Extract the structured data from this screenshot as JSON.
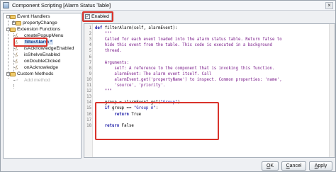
{
  "window": {
    "title": "Component Scripting [Alarm Status Table]"
  },
  "tree": {
    "event_handlers": "Event Handlers",
    "property_change": "propertyChange",
    "extension_functions": "Extension Functions",
    "functions": [
      {
        "label": "createPopupMenu"
      },
      {
        "label": "filterAlarm *",
        "selected": true
      },
      {
        "label": "isAcknowledgeEnabled"
      },
      {
        "label": "isShelveEnabled"
      },
      {
        "label": "onDoubleClicked"
      },
      {
        "label": "onAcknowledge"
      }
    ],
    "custom_methods": "Custom Methods",
    "add_method": "Add method"
  },
  "enabled": {
    "label": "Enabled",
    "checked": true
  },
  "code": {
    "lines": [
      {
        "n": "1",
        "parts": [
          {
            "c": "kw",
            "t": "def "
          },
          {
            "c": "plain",
            "t": "filterAlarm(self, alarmEvent):"
          }
        ]
      },
      {
        "n": "2",
        "parts": [
          {
            "c": "doc",
            "t": "    \"\"\""
          }
        ]
      },
      {
        "n": "3",
        "parts": [
          {
            "c": "doc",
            "t": "    Called for each event loaded into the alarm status table. Return false to"
          }
        ]
      },
      {
        "n": "4",
        "parts": [
          {
            "c": "doc",
            "t": "    hide this event from the table. This code is executed in a background"
          }
        ]
      },
      {
        "n": "5",
        "parts": [
          {
            "c": "doc",
            "t": "    thread."
          }
        ]
      },
      {
        "n": "6",
        "parts": [
          {
            "c": "doc",
            "t": ""
          }
        ]
      },
      {
        "n": "7",
        "parts": [
          {
            "c": "doc",
            "t": "    Arguments:"
          }
        ]
      },
      {
        "n": "8",
        "parts": [
          {
            "c": "doc",
            "t": "        self: A reference to the component that is invoking this function."
          }
        ]
      },
      {
        "n": "9",
        "parts": [
          {
            "c": "doc",
            "t": "        alarmEvent: The alarm event itself. Call"
          }
        ]
      },
      {
        "n": "10",
        "parts": [
          {
            "c": "doc",
            "t": "        alarmEvent.get('propertyName') to inspect. Common properties: 'name',"
          }
        ]
      },
      {
        "n": "11",
        "parts": [
          {
            "c": "doc",
            "t": "        'source', 'priority'."
          }
        ]
      },
      {
        "n": "12",
        "parts": [
          {
            "c": "doc",
            "t": "    \"\"\""
          }
        ]
      },
      {
        "n": "13",
        "parts": [
          {
            "c": "plain",
            "t": ""
          }
        ]
      },
      {
        "n": "14",
        "parts": [
          {
            "c": "plain",
            "t": "    group = alarmEvent.get("
          },
          {
            "c": "str",
            "t": "\"Group\""
          },
          {
            "c": "plain",
            "t": ")"
          }
        ]
      },
      {
        "n": "15",
        "parts": [
          {
            "c": "kw",
            "t": "    if "
          },
          {
            "c": "plain",
            "t": "group == "
          },
          {
            "c": "str",
            "t": "\"Group A\""
          },
          {
            "c": "plain",
            "t": ":"
          }
        ]
      },
      {
        "n": "16",
        "parts": [
          {
            "c": "kw",
            "t": "        return "
          },
          {
            "c": "plain",
            "t": "True"
          }
        ]
      },
      {
        "n": "17",
        "parts": [
          {
            "c": "plain",
            "t": ""
          }
        ]
      },
      {
        "n": "18",
        "parts": [
          {
            "c": "kw",
            "t": "    return "
          },
          {
            "c": "plain",
            "t": "False"
          }
        ]
      }
    ]
  },
  "buttons": {
    "ok": {
      "prefix": "",
      "mnemonic": "O",
      "rest": "K"
    },
    "cancel": {
      "prefix": "",
      "mnemonic": "C",
      "rest": "ancel"
    },
    "apply": {
      "prefix": "",
      "mnemonic": "A",
      "rest": "pply"
    }
  },
  "colors": {
    "highlight": "#d9332b",
    "keyword": "#1a1aa6",
    "docstring": "#7a1c8a"
  }
}
